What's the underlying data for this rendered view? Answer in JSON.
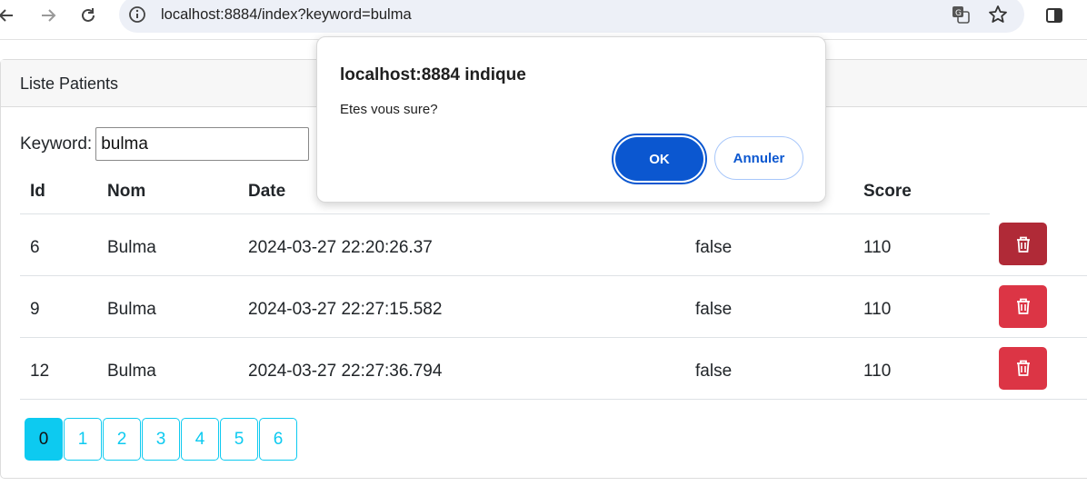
{
  "browser": {
    "url": "localhost:8884/index?keyword=bulma",
    "icons": [
      "back-arrow-icon",
      "forward-arrow-icon",
      "reload-icon",
      "site-info-icon",
      "translate-icon",
      "bookmark-star-icon",
      "side-panel-icon"
    ]
  },
  "card": {
    "title": "Liste Patients",
    "search": {
      "label": "Keyword:",
      "value": "bulma"
    },
    "table": {
      "headers": {
        "id": "Id",
        "nom": "Nom",
        "date": "Date",
        "malade": "",
        "score": "Score"
      },
      "rows": [
        {
          "id": "6",
          "nom": "Bulma",
          "date": "2024-03-27 22:20:26.37",
          "malade": "false",
          "score": "110"
        },
        {
          "id": "9",
          "nom": "Bulma",
          "date": "2024-03-27 22:27:15.582",
          "malade": "false",
          "score": "110"
        },
        {
          "id": "12",
          "nom": "Bulma",
          "date": "2024-03-27 22:27:36.794",
          "malade": "false",
          "score": "110"
        }
      ]
    },
    "pagination": {
      "pages": [
        "0",
        "1",
        "2",
        "3",
        "4",
        "5",
        "6"
      ],
      "current": "0"
    }
  },
  "dialog": {
    "title": "localhost:8884 indique",
    "message": "Etes vous sure?",
    "ok_label": "OK",
    "cancel_label": "Annuler"
  },
  "colors": {
    "danger": "#dc3545",
    "danger_active": "#b02a37",
    "info": "#0dcaf0",
    "dialog_primary": "#0b57d0"
  }
}
